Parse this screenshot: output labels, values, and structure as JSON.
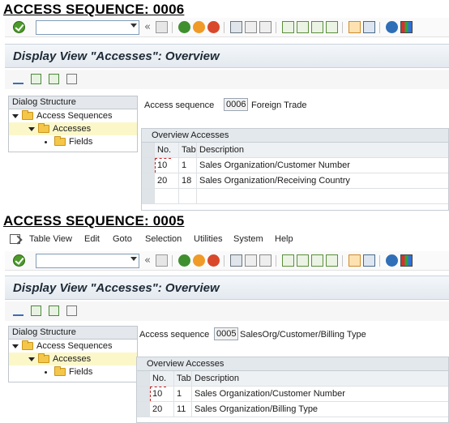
{
  "screens": [
    {
      "heading": "ACCESS SEQUENCE: 0006",
      "window_title": "Display View \"Accesses\": Overview",
      "dialog_structure": {
        "title": "Dialog Structure",
        "items": [
          {
            "label": "Access Sequences"
          },
          {
            "label": "Accesses"
          },
          {
            "label": "Fields"
          }
        ]
      },
      "access_sequence": {
        "label": "Access sequence",
        "value": "0006",
        "description": "Foreign Trade"
      },
      "table": {
        "title": "Overview Accesses",
        "columns": [
          "No.",
          "Tab",
          "Description"
        ],
        "rows": [
          {
            "no": "10",
            "tab": "1",
            "description": "Sales Organization/Customer Number"
          },
          {
            "no": "20",
            "tab": "18",
            "description": "Sales Organization/Receiving Country"
          }
        ]
      }
    },
    {
      "heading": "ACCESS SEQUENCE: 0005",
      "menu": [
        "Table View",
        "Edit",
        "Goto",
        "Selection",
        "Utilities",
        "System",
        "Help"
      ],
      "window_title": "Display View \"Accesses\": Overview",
      "dialog_structure": {
        "title": "Dialog Structure",
        "items": [
          {
            "label": "Access Sequences"
          },
          {
            "label": "Accesses"
          },
          {
            "label": "Fields"
          }
        ]
      },
      "access_sequence": {
        "label": "Access sequence",
        "value": "0005",
        "description": "SalesOrg/Customer/Billing Type"
      },
      "table": {
        "title": "Overview Accesses",
        "columns": [
          "No.",
          "Tab",
          "Description"
        ],
        "rows": [
          {
            "no": "10",
            "tab": "1",
            "description": "Sales Organization/Customer Number"
          },
          {
            "no": "20",
            "tab": "11",
            "description": "Sales Organization/Billing Type"
          }
        ]
      }
    }
  ],
  "toolbar_icons": [
    "enter-icon",
    "command-field",
    "collapse-icon",
    "save-icon",
    "back-icon",
    "exit-icon",
    "cancel-icon",
    "print-icon",
    "find-icon",
    "find-next-icon",
    "first-page-icon",
    "previous-page-icon",
    "next-page-icon",
    "last-page-icon",
    "create-session-icon",
    "shortcut-icon",
    "help-icon",
    "customize-layout-icon"
  ],
  "app_toolbar_icons": [
    "display-change-icon",
    "copy-icon",
    "details-icon",
    "select-all-icon"
  ],
  "colors": {
    "title_bar": "#e3e9ef",
    "selected_tree_row": "#fbf7c9",
    "folder": "#f4c64a",
    "ok_green": "#4c9a2a",
    "back_green": "#3f8f2e",
    "exit_orange": "#f09a27",
    "cancel_red": "#d9482b"
  }
}
